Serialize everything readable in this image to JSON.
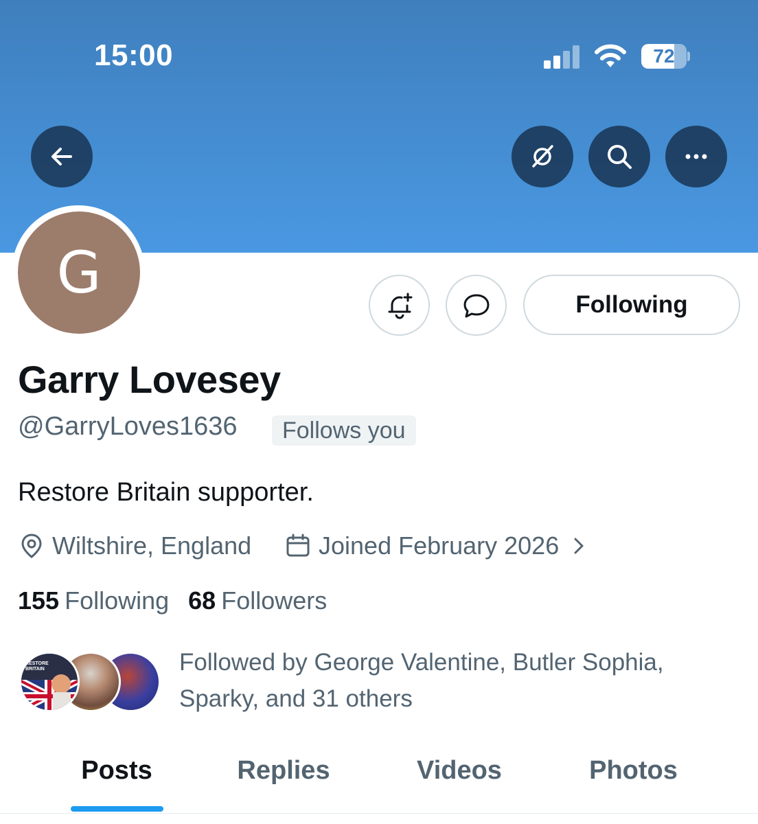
{
  "status_bar": {
    "time": "15:00",
    "battery": "72",
    "battery_level": 0.72,
    "signal_bars_active": 2,
    "signal_bars_total": 4
  },
  "header_buttons": {
    "back_icon": "arrow-left-icon",
    "grok_icon": "grok-slash-icon",
    "search_icon": "search-icon",
    "more_icon": "more-horizontal-icon"
  },
  "profile": {
    "avatar_letter": "G",
    "avatar_color": "#9c7c6b",
    "name": "Garry Lovesey",
    "handle": "@GarryLoves1636",
    "follows_you": "Follows you",
    "bio": "Restore Britain supporter.",
    "location": "Wiltshire, England",
    "joined": "Joined February 2026"
  },
  "actions": {
    "notify_icon": "bell-plus-icon",
    "message_icon": "message-bubble-icon",
    "following_label": "Following"
  },
  "counts": {
    "following_num": "155",
    "following_label": "Following",
    "followers_num": "68",
    "followers_label": "Followers"
  },
  "followed_by": {
    "text_line1": "Followed by George Valentine, Butler Sophia,",
    "text_line2": "Sparky, and 31 others",
    "avatar_logo_text": "RESTORE BRITAIN"
  },
  "tabs": [
    {
      "label": "Posts",
      "active": true
    },
    {
      "label": "Replies",
      "active": false
    },
    {
      "label": "Videos",
      "active": false
    },
    {
      "label": "Photos",
      "active": false
    }
  ],
  "colors": {
    "accent": "#1d9bf0",
    "banner_top": "#3f7fbd",
    "banner_bottom": "#4a98e2"
  }
}
